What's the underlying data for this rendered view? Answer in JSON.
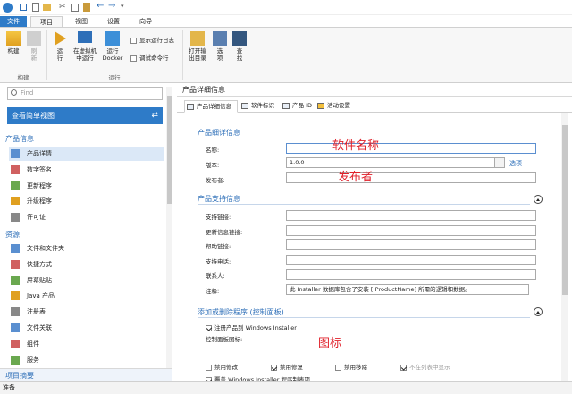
{
  "ribbon": {
    "tabs": [
      "文件",
      "项目",
      "视图",
      "设置",
      "向导"
    ],
    "active_tab": 1,
    "buttons": {
      "build": "构建",
      "refresh": "刷\n新",
      "run": "运\n行",
      "run_vm": "在虚拟机\n中运行",
      "run_docker": "运行\nDocker",
      "open_output": "打开输\n出目录",
      "options": "选\n项",
      "find": "查\n找"
    },
    "checks": {
      "show_log": "显示运行日志",
      "debug_cmd": "调试命令行"
    },
    "groups": {
      "build": "构建",
      "run": "运行"
    }
  },
  "sidebar": {
    "search_placeholder": "Find",
    "view_button": "查看简单视图",
    "section_product": "产品信息",
    "items_product": [
      {
        "label": "产品详情",
        "icon": "product-details-icon",
        "selected": true
      },
      {
        "label": "数字签名",
        "icon": "digital-signature-icon"
      },
      {
        "label": "更新程序",
        "icon": "updater-icon"
      },
      {
        "label": "升级程序",
        "icon": "upgrade-icon"
      },
      {
        "label": "许可证",
        "icon": "license-icon"
      }
    ],
    "section_resources": "资源",
    "items_resources": [
      {
        "label": "文件和文件夹",
        "icon": "folder-icon"
      },
      {
        "label": "快捷方式",
        "icon": "shortcut-icon"
      },
      {
        "label": "屏幕贴贴",
        "icon": "screen-icon"
      },
      {
        "label": "Java 产品",
        "icon": "java-icon"
      },
      {
        "label": "注册表",
        "icon": "registry-icon"
      },
      {
        "label": "文件关联",
        "icon": "file-association-icon"
      },
      {
        "label": "组件",
        "icon": "component-icon"
      },
      {
        "label": "服务",
        "icon": "service-icon"
      }
    ],
    "summary": "项目摘要"
  },
  "main": {
    "header": "产品详细信息",
    "tabs": [
      "产品详细信息",
      "软件标识",
      "产品 ID",
      "活动设置"
    ],
    "active_tab": 0,
    "section_details": "产品细详信息",
    "name_label": "名称:",
    "name_value": "",
    "version_label": "版本:",
    "version_value": "1.0.0",
    "version_options": "选项",
    "publisher_label": "发布者:",
    "publisher_value": "",
    "annot_name": "软件名称",
    "annot_publisher": "发布者",
    "section_support": "产品支持信息",
    "support_labels": [
      "支持链接:",
      "更新信息链接:",
      "帮助链接:",
      "支持电话:",
      "联系人:",
      "注释:"
    ],
    "comment_value": "此 Installer 数据库包含了安装 [|ProductName] 所需的逻辑和数据。",
    "section_arp": "添加或删除程序 (控制面板)",
    "register_label": "注册产品到 Windows Installer",
    "cp_icon_label": "控制面板图标:",
    "annot_icon": "图标",
    "checks": [
      {
        "label": "禁用修改",
        "checked": false,
        "disabled": false
      },
      {
        "label": "禁用修复",
        "checked": true,
        "disabled": false
      },
      {
        "label": "禁用移除",
        "checked": false,
        "disabled": false
      },
      {
        "label": "不在列表中显示",
        "checked": true,
        "disabled": true
      }
    ],
    "override_label": "覆盖 Windows Installer 程序制表项"
  },
  "status": "准备"
}
